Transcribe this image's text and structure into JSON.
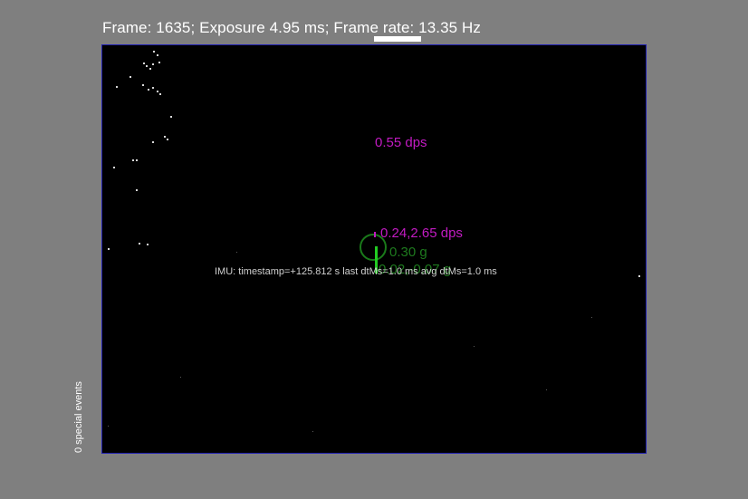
{
  "header": {
    "status_text": "Frame: 1635; Exposure 4.95 ms; Frame rate: 13.35 Hz"
  },
  "overlay": {
    "gyro_rate": "0.55 dps",
    "gyro_pan_tilt": "0.24,2.65 dps",
    "accel_magnitude": "0.30 g",
    "accel_components": "0.02,-0.07 g",
    "imu_info": "IMU: timestamp=+125.812 s last dtMs=1.0   ms  avg dtMs=1.0   ms"
  },
  "sidebar": {
    "special_events": "0 special events"
  },
  "colors": {
    "background": "#7f7f7f",
    "viewport": "#000000",
    "viewport_border": "#2020b0",
    "gyro_text": "#c21bc2",
    "accel_text": "#1e7a1e",
    "accel_vector": "#22cc22"
  }
}
